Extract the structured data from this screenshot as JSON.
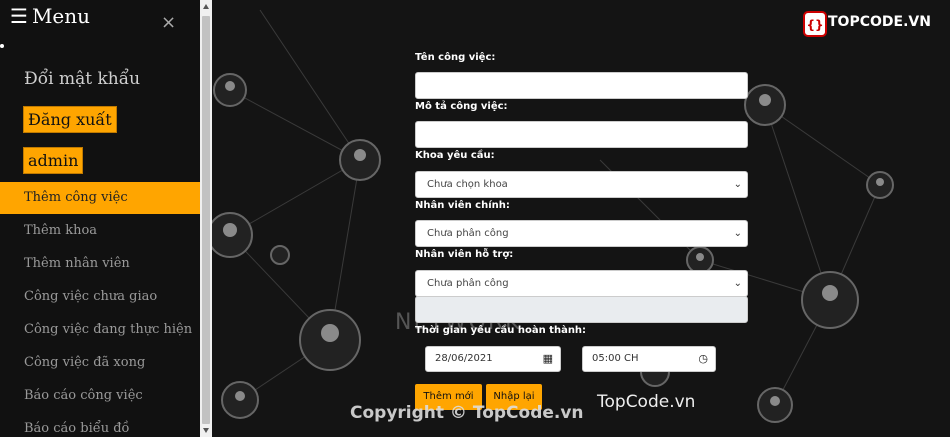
{
  "sidebar": {
    "title": "Menu",
    "close_symbol": "×",
    "change_password": "Đổi mật khẩu",
    "logout": "Đăng xuất",
    "user": "admin",
    "items": [
      {
        "label": "Thêm công việc",
        "active": true
      },
      {
        "label": "Thêm khoa"
      },
      {
        "label": "Thêm nhân viên"
      },
      {
        "label": "Công việc chưa giao"
      },
      {
        "label": "Công việc đang thực hiện"
      },
      {
        "label": "Công việc đã xong"
      },
      {
        "label": "Báo cáo công việc"
      },
      {
        "label": "Báo cáo biểu đồ"
      }
    ]
  },
  "form": {
    "task_name_label": "Tên công việc:",
    "task_desc_label": "Mô tả công việc:",
    "dept_label": "Khoa yêu cầu:",
    "dept_value": "Chưa chọn khoa",
    "main_staff_label": "Nhân viên chính:",
    "main_staff_value": "Chưa phân công",
    "support_staff_label": "Nhân viên hỗ trợ:",
    "support_staff_value": "Chưa phân công",
    "deadline_label": "Thời gian yêu cầu hoàn thành:",
    "date_value": "28/06/2021",
    "time_value": "05:00 CH",
    "submit_label": "Thêm mới",
    "reset_label": "Nhập lại"
  },
  "branding": {
    "logo_text": "TOPCODE.VN",
    "watermark_copyright": "Copyright © TopCode.vn",
    "watermark_site": "TopCode.vn",
    "background_text": "NETWORK"
  },
  "colors": {
    "accent": "#ffa500",
    "sidebar_bg": "#111111"
  }
}
